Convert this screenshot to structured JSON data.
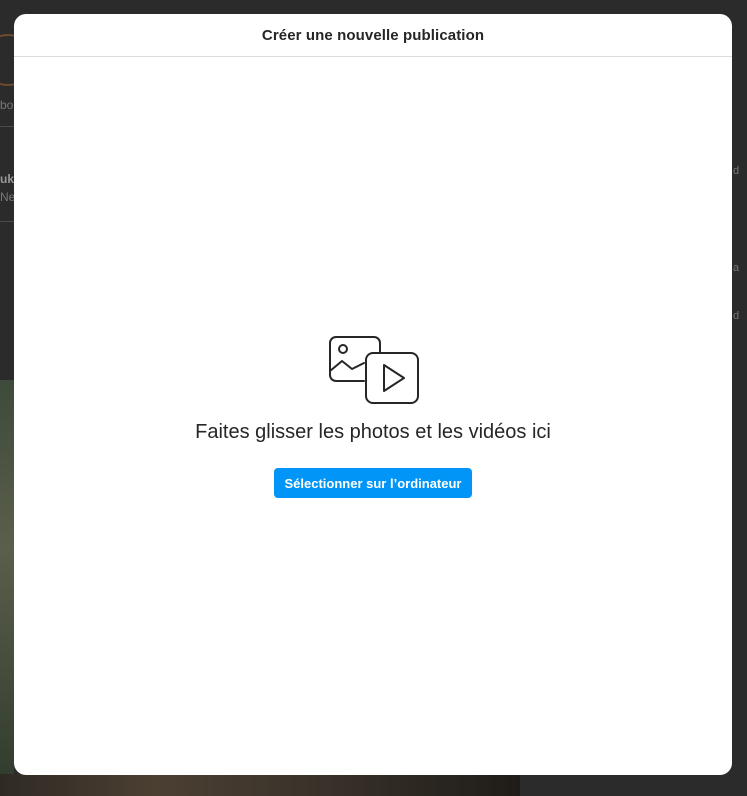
{
  "background": {
    "left_fragments": [
      "bo",
      "uka",
      "Ne"
    ],
    "right_fragments": [
      "d",
      "a",
      "d"
    ]
  },
  "modal": {
    "title": "Créer une nouvelle publication",
    "drop_text": "Faites glisser les photos et les vidéos ici",
    "select_button_label": "Sélectionner sur l’ordinateur",
    "icon": "photo-video-icon"
  },
  "colors": {
    "accent": "#0095f6",
    "text": "#262626",
    "divider": "#dbdbdb",
    "overlay": "#2b2b2b"
  }
}
